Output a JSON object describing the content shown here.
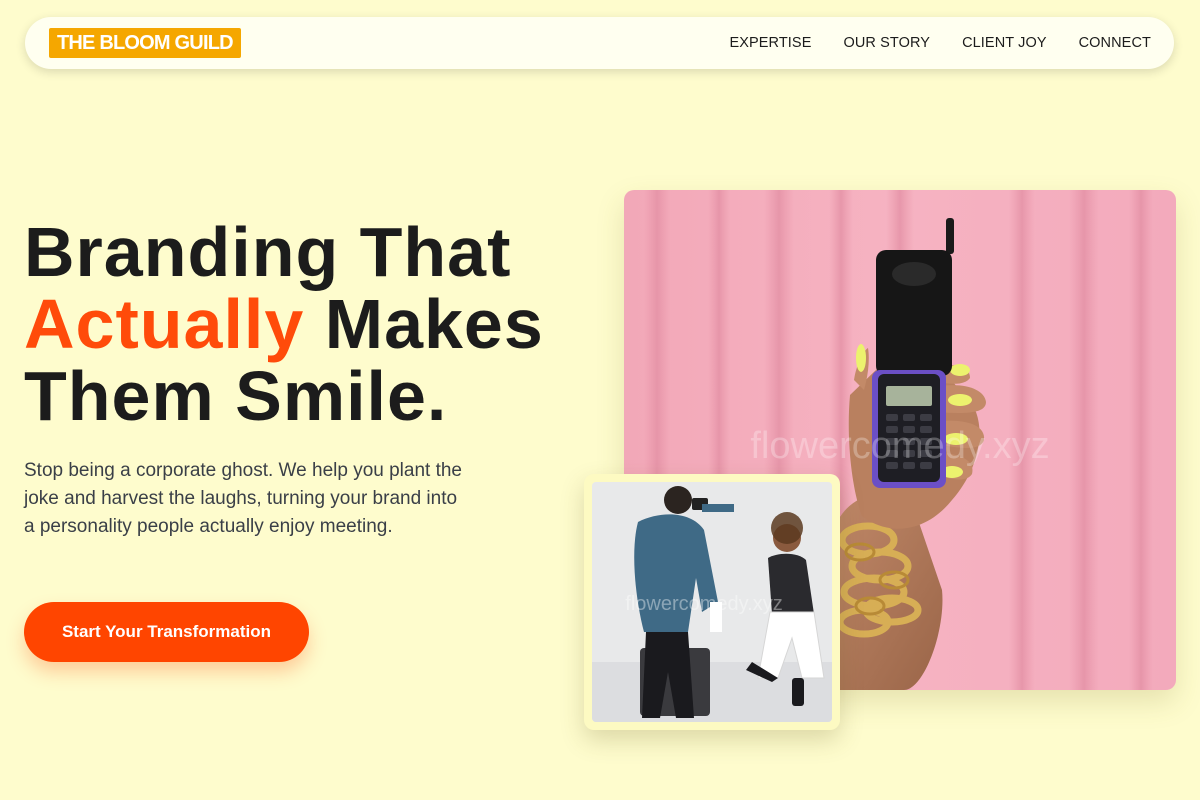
{
  "nav": {
    "logo": "THE BLOOM GUILD",
    "links": [
      "EXPERTISE",
      "OUR STORY",
      "CLIENT JOY",
      "CONNECT"
    ]
  },
  "hero": {
    "headline_line1": "Branding That",
    "headline_accent": "Actually",
    "headline_line2_rest": " Makes",
    "headline_line3": "Them Smile.",
    "subtext": "Stop being a corporate ghost. We help you plant the joke and harvest the laughs, turning your brand into a personality people actually enjoy meeting.",
    "cta_label": "Start Your Transformation"
  },
  "images": {
    "watermark": "flowercomedy.xyz"
  },
  "colors": {
    "background": "#fefccd",
    "accent": "#ff4b0a",
    "logo_bg": "#f5a700",
    "cta_bg": "#ff4500"
  }
}
